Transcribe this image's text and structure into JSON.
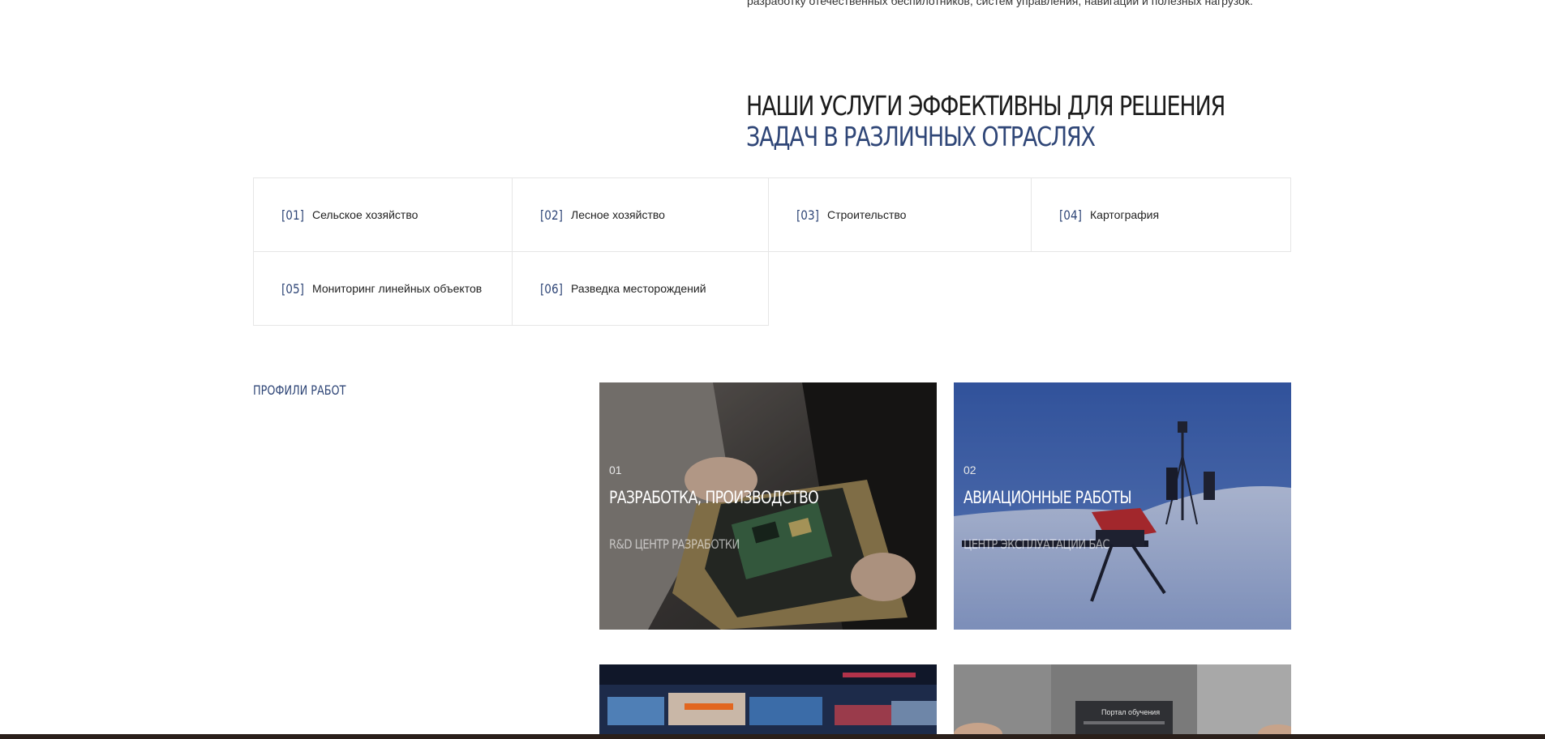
{
  "intro": {
    "text": "разработку отечественных беспилотников, систем управления, навигации и полезных нагрузок."
  },
  "heading": {
    "line1": "НАШИ УСЛУГИ ЭФФЕКТИВНЫ ДЛЯ РЕШЕНИЯ",
    "line2": "ЗАДАЧ В РАЗЛИЧНЫХ ОТРАСЛЯХ"
  },
  "industries": [
    {
      "num": "[01]",
      "label": "Сельское хозяйство"
    },
    {
      "num": "[02]",
      "label": "Лесное хозяйство"
    },
    {
      "num": "[03]",
      "label": "Строительство"
    },
    {
      "num": "[04]",
      "label": "Картография"
    },
    {
      "num": "[05]",
      "label": "Мониторинг линейных объектов"
    },
    {
      "num": "[06]",
      "label": "Разведка месторождений"
    }
  ],
  "profiles": {
    "label": "ПРОФИЛИ РАБОТ",
    "cards": [
      {
        "num": "01",
        "title": "РАЗРАБОТКА, ПРОИЗВОДСТВО",
        "subtitle": "R&D ЦЕНТР РАЗРАБОТКИ"
      },
      {
        "num": "02",
        "title": "АВИАЦИОННЫЕ РАБОТЫ",
        "subtitle": "ЦЕНТР ЭКСПЛУАТАЦИИ БАС"
      },
      {
        "num": "",
        "title": "",
        "subtitle": ""
      },
      {
        "num": "",
        "title": "",
        "subtitle": ""
      }
    ]
  },
  "colors": {
    "accent": "#2f4677",
    "text": "#1c1c1c",
    "border": "#e6e6e6"
  },
  "card4_screen_text": "Портал обучения"
}
